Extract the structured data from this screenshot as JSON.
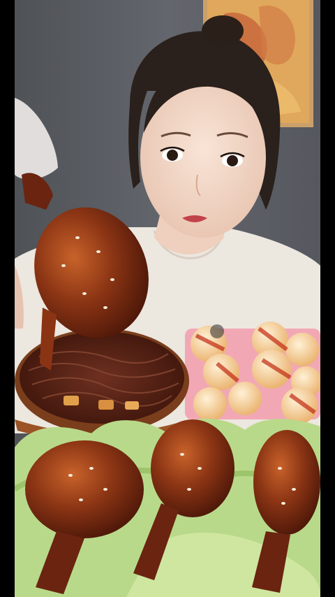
{
  "scene": {
    "description_free": true,
    "colors": {
      "letterbox": "#000000",
      "wall": "#5a5d63",
      "shirt": "#ece7df",
      "hair": "#2a201c",
      "skin": "#f2d9c9",
      "glaze": "#7a2a10",
      "lettuce": "#b9d98a",
      "noodles": "#5a2616",
      "bowl": "#8a4a24",
      "tray": "#f2a8b4",
      "painting": "#d79a52"
    },
    "icons": {
      "person": "person-figure",
      "drumstick_held": "drumstick-icon",
      "noodle_bowl": "noodle-bowl-icon",
      "buns": "dumpling-icon",
      "lettuce": "lettuce-icon"
    }
  }
}
